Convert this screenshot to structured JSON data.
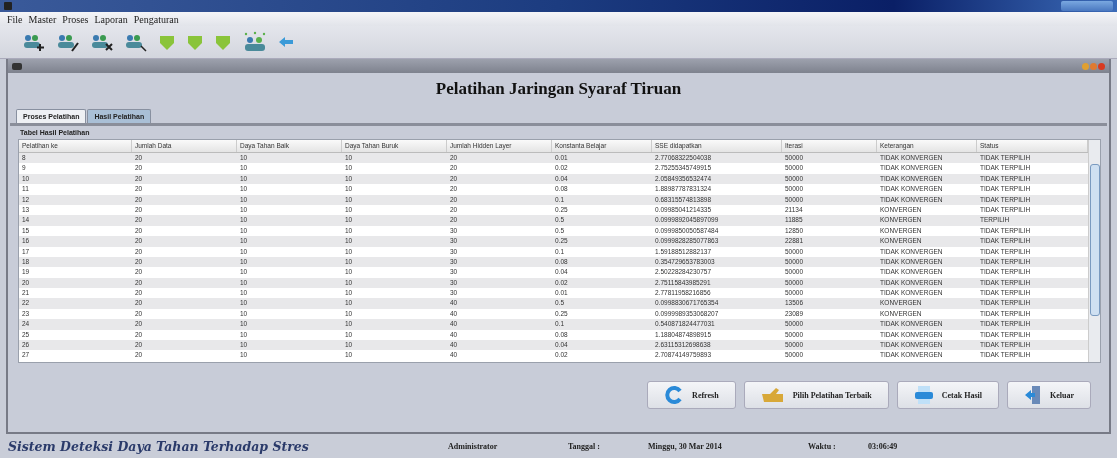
{
  "menu": [
    {
      "label": "File"
    },
    {
      "label": "Master"
    },
    {
      "label": "Proses"
    },
    {
      "label": "Laporan"
    },
    {
      "label": "Pengaturan"
    }
  ],
  "toolbar": [
    {
      "kind": "add"
    },
    {
      "kind": "edit"
    },
    {
      "kind": "delete"
    },
    {
      "kind": "search"
    },
    {
      "kind": "green"
    },
    {
      "kind": "green"
    },
    {
      "kind": "green"
    },
    {
      "kind": "group"
    },
    {
      "kind": "blue"
    }
  ],
  "frame": {
    "title": "Pelatihan Jaringan Syaraf Tiruan"
  },
  "tabs": [
    {
      "label": "Proses Pelatihan",
      "selected": false
    },
    {
      "label": "Hasil Pelatihan",
      "selected": true
    }
  ],
  "table_panel": {
    "title": "Tabel Hasil Pelatihan"
  },
  "table": {
    "columns": [
      "Pelatihan ke",
      "Jumlah Data",
      "Daya Tahan Baik",
      "Daya Tahan Buruk",
      "Jumlah Hidden Layer",
      "Konstanta Belajar",
      "SSE didapatkan",
      "Iterasi",
      "Keterangan",
      "Status"
    ],
    "rows": [
      [
        "8",
        "20",
        "10",
        "10",
        "20",
        "0.01",
        "2.77068322504038",
        "50000",
        "TIDAK KONVERGEN",
        "TIDAK TERPILIH"
      ],
      [
        "9",
        "20",
        "10",
        "10",
        "20",
        "0.02",
        "2.75255345749915",
        "50000",
        "TIDAK KONVERGEN",
        "TIDAK TERPILIH"
      ],
      [
        "10",
        "20",
        "10",
        "10",
        "20",
        "0.04",
        "2.05849356532474",
        "50000",
        "TIDAK KONVERGEN",
        "TIDAK TERPILIH"
      ],
      [
        "11",
        "20",
        "10",
        "10",
        "20",
        "0.08",
        "1.88987787831324",
        "50000",
        "TIDAK KONVERGEN",
        "TIDAK TERPILIH"
      ],
      [
        "12",
        "20",
        "10",
        "10",
        "20",
        "0.1",
        "0.68315574813898",
        "50000",
        "TIDAK KONVERGEN",
        "TIDAK TERPILIH"
      ],
      [
        "13",
        "20",
        "10",
        "10",
        "20",
        "0.25",
        "0.09985041214335",
        "21134",
        "KONVERGEN",
        "TIDAK TERPILIH"
      ],
      [
        "14",
        "20",
        "10",
        "10",
        "20",
        "0.5",
        "0.0999892045897099",
        "11885",
        "KONVERGEN",
        "TERPILIH"
      ],
      [
        "15",
        "20",
        "10",
        "10",
        "30",
        "0.5",
        "0.0999850050587484",
        "12850",
        "KONVERGEN",
        "TIDAK TERPILIH"
      ],
      [
        "16",
        "20",
        "10",
        "10",
        "30",
        "0.25",
        "0.0999828285077863",
        "22881",
        "KONVERGEN",
        "TIDAK TERPILIH"
      ],
      [
        "17",
        "20",
        "10",
        "10",
        "30",
        "0.1",
        "1.59188512882137",
        "50000",
        "TIDAK KONVERGEN",
        "TIDAK TERPILIH"
      ],
      [
        "18",
        "20",
        "10",
        "10",
        "30",
        "0.08",
        "0.354729653783003",
        "50000",
        "TIDAK KONVERGEN",
        "TIDAK TERPILIH"
      ],
      [
        "19",
        "20",
        "10",
        "10",
        "30",
        "0.04",
        "2.50228284230757",
        "50000",
        "TIDAK KONVERGEN",
        "TIDAK TERPILIH"
      ],
      [
        "20",
        "20",
        "10",
        "10",
        "30",
        "0.02",
        "2.75115843985291",
        "50000",
        "TIDAK KONVERGEN",
        "TIDAK TERPILIH"
      ],
      [
        "21",
        "20",
        "10",
        "10",
        "30",
        "0.01",
        "2.77811958216856",
        "50000",
        "TIDAK KONVERGEN",
        "TIDAK TERPILIH"
      ],
      [
        "22",
        "20",
        "10",
        "10",
        "40",
        "0.5",
        "0.0998830671765354",
        "13506",
        "KONVERGEN",
        "TIDAK TERPILIH"
      ],
      [
        "23",
        "20",
        "10",
        "10",
        "40",
        "0.25",
        "0.0999989353068207",
        "23089",
        "KONVERGEN",
        "TIDAK TERPILIH"
      ],
      [
        "24",
        "20",
        "10",
        "10",
        "40",
        "0.1",
        "0.540871824477031",
        "50000",
        "TIDAK KONVERGEN",
        "TIDAK TERPILIH"
      ],
      [
        "25",
        "20",
        "10",
        "10",
        "40",
        "0.08",
        "1.18804874898915",
        "50000",
        "TIDAK KONVERGEN",
        "TIDAK TERPILIH"
      ],
      [
        "26",
        "20",
        "10",
        "10",
        "40",
        "0.04",
        "2.63115312698638",
        "50000",
        "TIDAK KONVERGEN",
        "TIDAK TERPILIH"
      ],
      [
        "27",
        "20",
        "10",
        "10",
        "40",
        "0.02",
        "2.70874149759893",
        "50000",
        "TIDAK KONVERGEN",
        "TIDAK TERPILIH"
      ]
    ]
  },
  "buttons": [
    {
      "kind": "refresh",
      "label": "Refresh"
    },
    {
      "kind": "pick",
      "label": "Pilih Pelatihan Terbaik"
    },
    {
      "kind": "print",
      "label": "Cetak Hasil"
    },
    {
      "kind": "exit",
      "label": "Keluar"
    }
  ],
  "status_bar": {
    "app_name": "Sistem Deteksi Daya Tahan Terhadap Stres",
    "user": "Administrator",
    "date_label": "Tanggal :",
    "date": "Minggu, 30 Mar 2014",
    "time_label": "Waktu :",
    "time": "03:06:49"
  }
}
